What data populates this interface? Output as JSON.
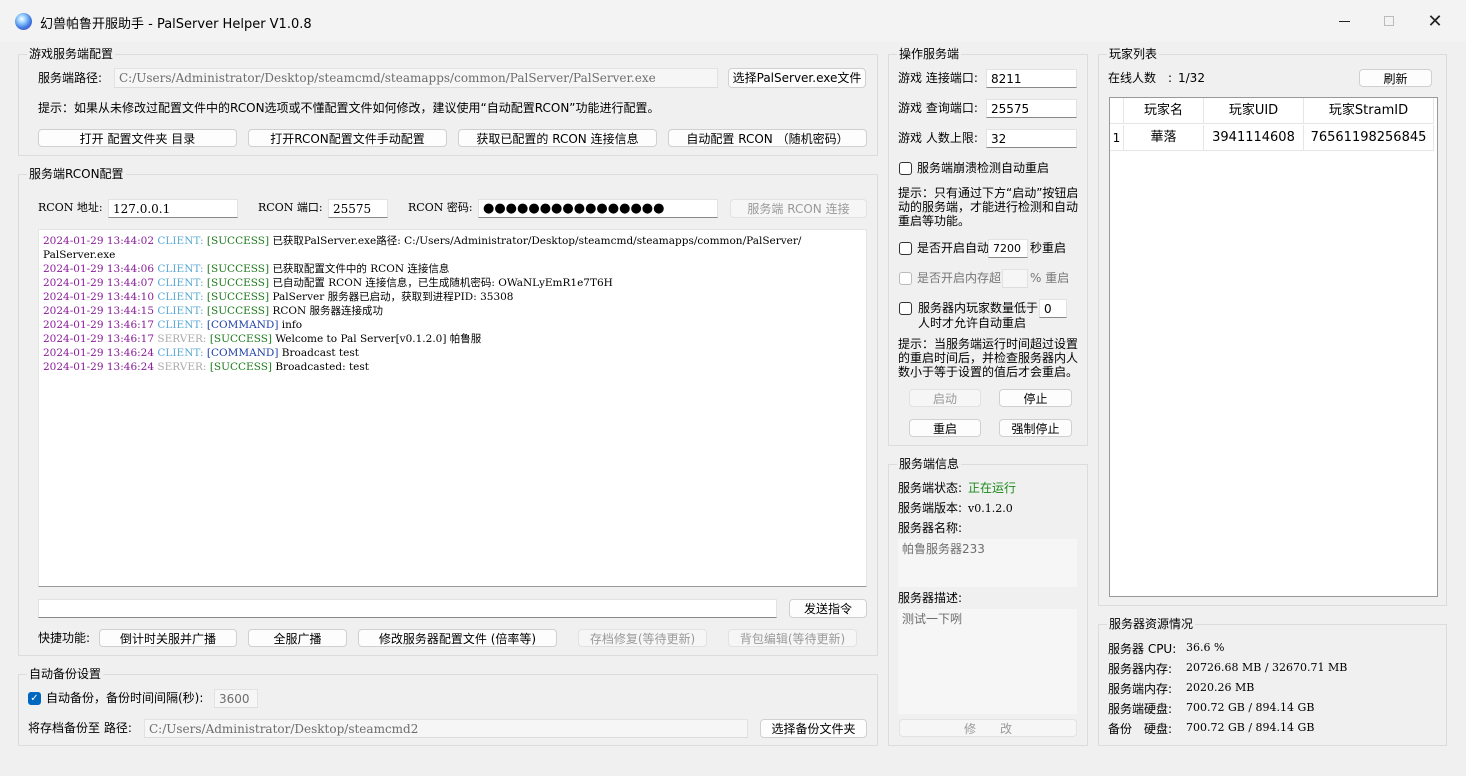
{
  "window": {
    "title": "幻兽帕鲁开服助手 - PalServer Helper V1.0.8",
    "minimize": "minimize",
    "maximize": "maximize",
    "close": "✕"
  },
  "game_config": {
    "title": "游戏服务端配置",
    "path_label": "服务端路径:",
    "path_value": "C:/Users/Administrator/Desktop/steamcmd/steamapps/common/PalServer/PalServer.exe",
    "select_exe": "选择PalServer.exe文件",
    "hint": "提示：如果从未修改过配置文件中的RCON选项或不懂配置文件如何修改，建议使用“自动配置RCON”功能进行配置。",
    "buttons": [
      "打开 配置文件夹 目录",
      "打开RCON配置文件手动配置",
      "获取已配置的 RCON 连接信息",
      "自动配置 RCON （随机密码）"
    ]
  },
  "rcon": {
    "title": "服务端RCON配置",
    "addr_label": "RCON 地址:",
    "addr_value": "127.0.0.1",
    "port_label": "RCON 端口:",
    "port_value": "25575",
    "pwd_label": "RCON 密码:",
    "pwd_value": "●●●●●●●●●●●●●●●●",
    "connect": "服务端 RCON 连接"
  },
  "log": [
    {
      "time": "2024-01-29 13:44:02",
      "src": "CLIENT:",
      "srcType": "client",
      "tag": "[SUCCESS]",
      "tagType": "success",
      "msg": "已获取PalServer.exe路径: C:/Users/Administrator/Desktop/steamcmd/steamapps/common/PalServer/",
      "cont": "PalServer.exe"
    },
    {
      "time": "2024-01-29 13:44:06",
      "src": "CLIENT:",
      "srcType": "client",
      "tag": "[SUCCESS]",
      "tagType": "success",
      "msg": "已获取配置文件中的 RCON 连接信息"
    },
    {
      "time": "2024-01-29 13:44:07",
      "src": "CLIENT:",
      "srcType": "client",
      "tag": "[SUCCESS]",
      "tagType": "success",
      "msg": "已自动配置 RCON 连接信息，已生成随机密码: OWaNLyEmR1e7T6H"
    },
    {
      "time": "2024-01-29 13:44:10",
      "src": "CLIENT:",
      "srcType": "client",
      "tag": "[SUCCESS]",
      "tagType": "success",
      "msg": "PalServer 服务器已启动，获取到进程PID: 35308"
    },
    {
      "time": "2024-01-29 13:44:15",
      "src": "CLIENT:",
      "srcType": "client",
      "tag": "[SUCCESS]",
      "tagType": "success",
      "msg": "RCON 服务器连接成功"
    },
    {
      "time": "2024-01-29 13:46:17",
      "src": "CLIENT:",
      "srcType": "client",
      "tag": "[COMMAND]",
      "tagType": "command",
      "msg": "info"
    },
    {
      "time": "2024-01-29 13:46:17",
      "src": "SERVER:",
      "srcType": "server",
      "tag": "[SUCCESS]",
      "tagType": "success",
      "msg": "Welcome to Pal Server[v0.1.2.0] 帕鲁服"
    },
    {
      "time": "2024-01-29 13:46:24",
      "src": "CLIENT:",
      "srcType": "client",
      "tag": "[COMMAND]",
      "tagType": "command",
      "msg": "Broadcast test"
    },
    {
      "time": "2024-01-29 13:46:24",
      "src": "SERVER:",
      "srcType": "server",
      "tag": "[SUCCESS]",
      "tagType": "success",
      "msg": "Broadcasted: test"
    }
  ],
  "command": {
    "value": "",
    "send": "发送指令"
  },
  "quick": {
    "label": "快捷功能:",
    "buttons": [
      "倒计时关服并广播",
      "全服广播",
      "修改服务器配置文件 (倍率等)",
      "存档修复(等待更新)",
      "背包编辑(等待更新)"
    ]
  },
  "backup": {
    "title": "自动备份设置",
    "auto_label": "自动备份，备份时间间隔(秒):",
    "interval": "3600",
    "path_label": "将存档备份至 路径:",
    "path_value": "C:/Users/Administrator/Desktop/steamcmd2",
    "select": "选择备份文件夹"
  },
  "ops": {
    "title": "操作服务端",
    "conn_port_label": "游戏 连接端口:",
    "conn_port": "8211",
    "query_port_label": "游戏 查询端口:",
    "query_port": "25575",
    "max_players_label": "游戏 人数上限:",
    "max_players": "32",
    "crash_restart": "服务端崩溃检测自动重启",
    "hint1": "提示：只有通过下方“启动”按钮启动的服务端，才能进行检测和自动重启等功能。",
    "auto_restart_label": "是否开启自动",
    "auto_restart_value": "7200",
    "auto_restart_suffix": "秒重启",
    "mem_restart_label": "是否开启内存超",
    "mem_restart_suffix": "% 重启",
    "player_cond_label": "服务器内玩家数量低于",
    "player_cond_value": "0",
    "player_cond_suffix": "人时才允许自动重启",
    "hint2": "提示：当服务端运行时间超过设置的重启时间后，并检查服务器内人数小于等于设置的值后才会重启。",
    "start": "启动",
    "stop": "停止",
    "restart": "重启",
    "force_stop": "强制停止"
  },
  "info": {
    "title": "服务端信息",
    "status_label": "服务端状态:",
    "status_value": "正在运行",
    "status_color": "#1a8a1a",
    "version_label": "服务端版本:",
    "version_value": "v0.1.2.0",
    "name_label": "服务器名称:",
    "name_value": "帕鲁服务器233",
    "desc_label": "服务器描述:",
    "desc_value": "测试一下咧",
    "modify": "修　　改"
  },
  "players": {
    "title": "玩家列表",
    "online_label": "在线人数　:",
    "online_value": "1/32",
    "refresh": "刷新",
    "columns": [
      "玩家名",
      "玩家UID",
      "玩家StramID"
    ],
    "rows": [
      {
        "index": "1",
        "name": "華落",
        "uid": "3941114608",
        "steamid": "76561198256845"
      }
    ]
  },
  "resources": {
    "title": "服务器资源情况",
    "items": [
      {
        "label": "服务器 CPU:",
        "value": "36.6 %"
      },
      {
        "label": "服务器内存:",
        "value": "20726.68 MB / 32670.71 MB"
      },
      {
        "label": "服务端内存:",
        "value": "2020.26 MB"
      },
      {
        "label": "服务端硬盘:",
        "value": "700.72 GB / 894.14 GB"
      },
      {
        "label": "备份　硬盘:",
        "value": "700.72 GB / 894.14 GB"
      }
    ]
  }
}
